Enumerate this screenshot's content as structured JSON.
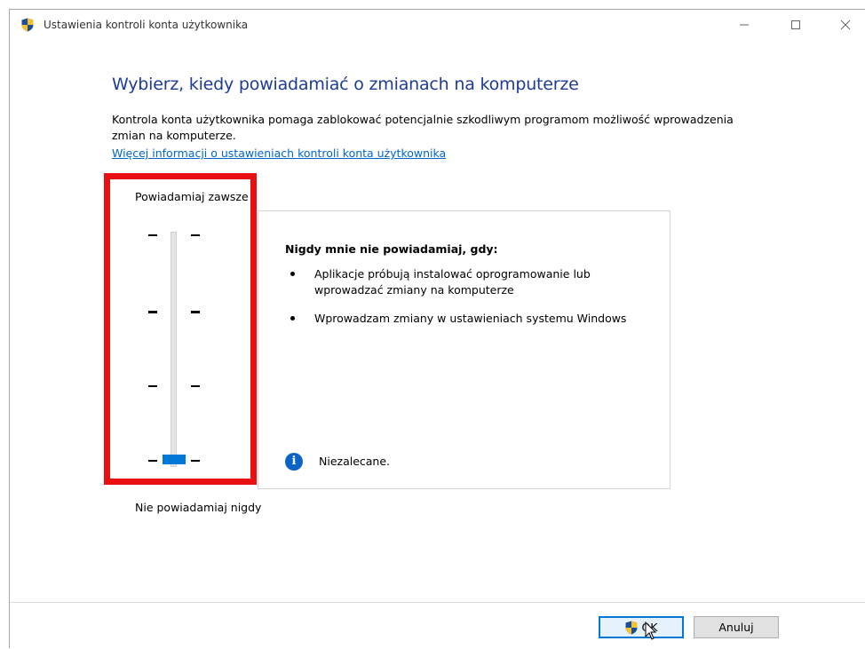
{
  "window": {
    "title": "Ustawienia kontroli konta użytkownika",
    "icon": "uac-shield-icon",
    "controls": [
      "minimize-icon",
      "maximize-icon",
      "close-icon"
    ]
  },
  "main": {
    "heading": "Wybierz, kiedy powiadamiać o zmianach na komputerze",
    "description": "Kontrola konta użytkownika pomaga zablokować potencjalnie szkodliwym programom możliwość wprowadzenia zmian na komputerze.",
    "more_info_link": "Więcej informacji o ustawieniach kontroli konta użytkownika"
  },
  "slider": {
    "top_label": "Powiadamiaj zawsze",
    "bottom_label": "Nie powiadamiaj nigdy",
    "levels": 4,
    "selected_level": 1,
    "accent_color": "#0078d7",
    "highlight_color": "#e81010"
  },
  "info_panel": {
    "title": "Nigdy mnie nie powiadamiaj, gdy:",
    "bullets": [
      "Aplikacje próbują instalować oprogramowanie lub wprowadzać zmiany na komputerze",
      "Wprowadzam zmiany w ustawieniach systemu Windows"
    ],
    "notice": "Niezalecane.",
    "notice_icon": "info-icon"
  },
  "footer": {
    "ok_label": "OK",
    "cancel_label": "Anuluj"
  },
  "colors": {
    "heading": "#1e3c96",
    "link": "#0066cc"
  }
}
